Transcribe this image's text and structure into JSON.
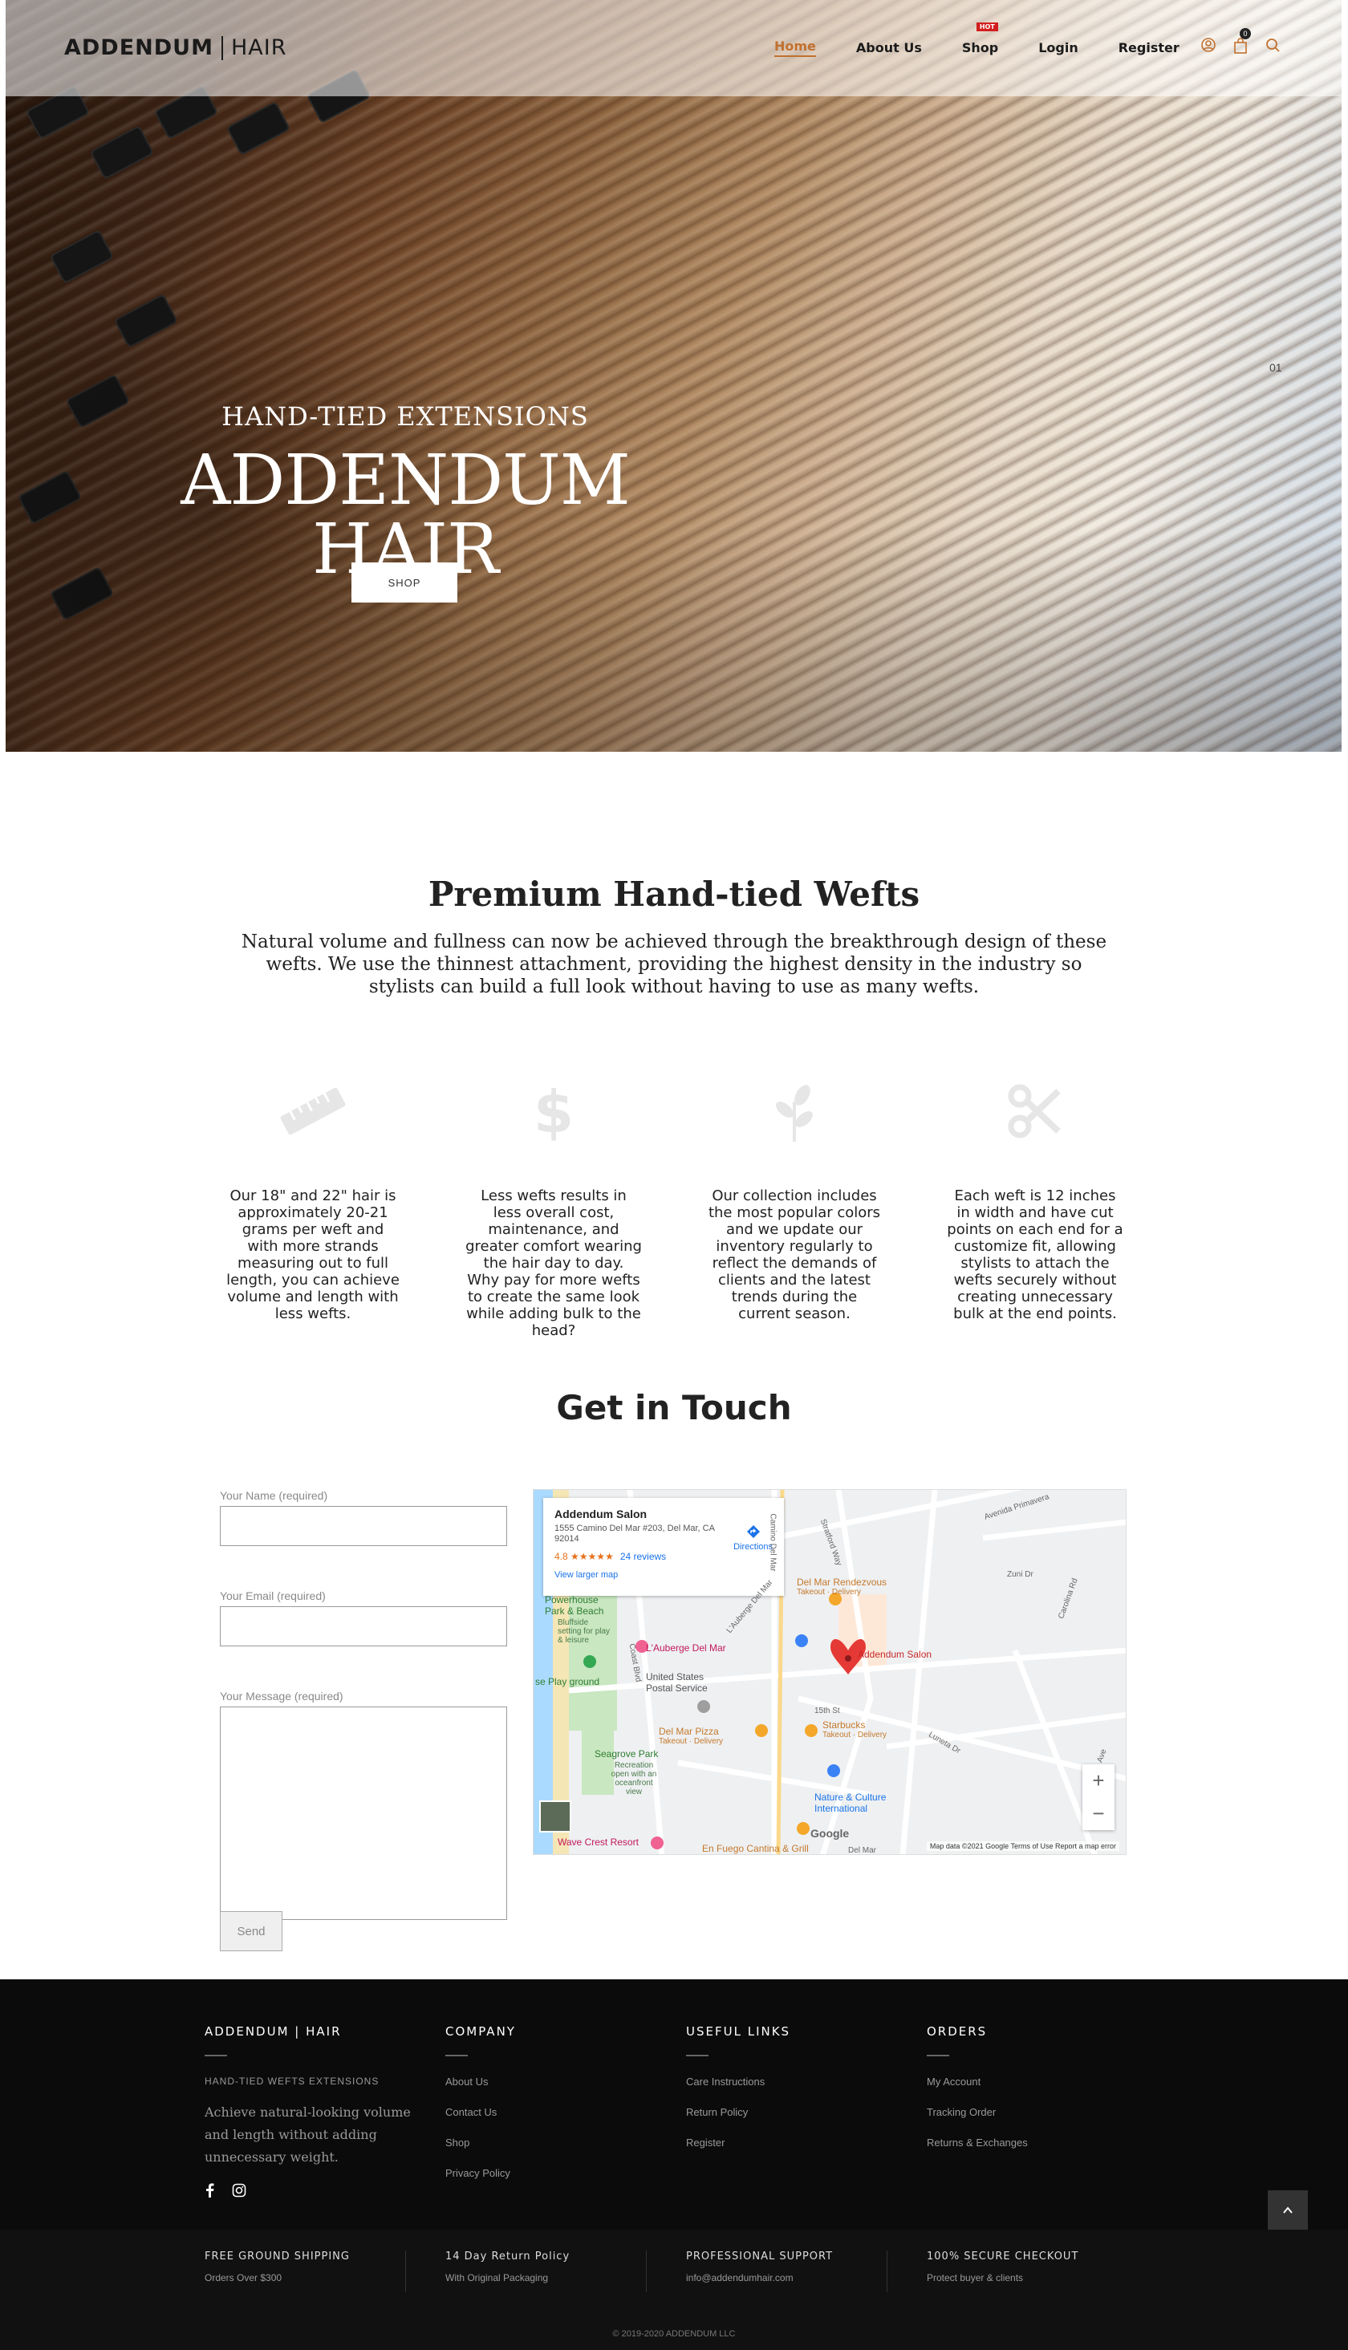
{
  "header": {
    "logo_main": "ADDENDUM",
    "logo_thin": "HAIR",
    "nav": [
      {
        "label": "Home"
      },
      {
        "label": "About Us"
      },
      {
        "label": "Shop",
        "badge": "HOT"
      },
      {
        "label": "Login"
      },
      {
        "label": "Register"
      }
    ],
    "cart_count": "0",
    "accent_color": "#c2702e"
  },
  "hero": {
    "subtitle": "HAND-TIED EXTENSIONS",
    "title": "ADDENDUM HAIR",
    "button": "SHOP",
    "slide_number": "01"
  },
  "premium": {
    "title": "Premium Hand-tied Wefts",
    "description": "Natural volume and fullness can now be achieved through the breakthrough design of these wefts. We use the thinnest attachment, providing the highest density in the industry so stylists can build a full look without having to use as many wefts."
  },
  "features": [
    {
      "icon": "ruler-icon",
      "text": "Our 18\" and 22\" hair is approximately 20-21 grams per weft and with more strands measuring out to full length, you can achieve volume and length with less wefts."
    },
    {
      "icon": "dollar-icon",
      "text": "Less wefts results in less overall cost, maintenance, and greater comfort wearing the hair day to day. Why pay for more wefts to create the same look while adding bulk to the head?"
    },
    {
      "icon": "leaf-icon",
      "text": "Our collection includes the most popular colors and we update our inventory regularly to reflect the demands of clients and the latest trends during the current season."
    },
    {
      "icon": "scissors-icon",
      "text": "Each weft is 12 inches in width and have cut points on each end for a customize fit, allowing stylists to attach the wefts securely without creating unnecessary bulk at the end points."
    }
  ],
  "contact": {
    "title": "Get in Touch",
    "name_label": "Your Name (required)",
    "email_label": "Your Email (required)",
    "message_label": "Your Message (required)",
    "send": "Send"
  },
  "map": {
    "place": "Addendum Salon",
    "address": "1555 Camino Del Mar #203, Del Mar, CA 92014",
    "rating": "4.8",
    "stars": "★★★★★",
    "reviews": "24 reviews",
    "larger": "View larger map",
    "directions": "Directions",
    "labels": {
      "rendezvous": "Del Mar Rendezvous",
      "rendezvous_sub": "Takeout · Delivery",
      "powerhouse": "Powerhouse Park & Beach",
      "bluffside": "Bluffside setting for play & leisure",
      "auberge": "L'Auberge Del Mar",
      "postal": "United States Postal Service",
      "play": "se Play ground",
      "pizza": "Del Mar Pizza",
      "pizza_sub": "Takeout · Delivery",
      "starbucks": "Starbucks",
      "starbucks_sub": "Takeout · Delivery",
      "seagrove": "Seagrove Park",
      "seagrove_sub": "Recreation open with an oceanfront view",
      "nature": "Nature & Culture International",
      "wave": "Wave Crest Resort",
      "fuego": "En Fuego Cantina & Grill",
      "salon_pin": "Addendum Salon",
      "st15": "15th St",
      "camino": "Camino Del Mar",
      "lauberge_st": "L'Auberge Del Mar",
      "primavera": "Avenida Primavera",
      "zuni": "Zuni Dr",
      "luneta": "Luneta Dr",
      "carolina": "Carolina Rd",
      "stratford": "Stratford Way",
      "coast": "Coast Blvd",
      "ave": "Ave",
      "del_mar_short": "Del Mar"
    },
    "google": "Google",
    "footer": "Map data ©2021 Google   Terms of Use   Report a map error",
    "zoom_in": "+",
    "zoom_out": "−"
  },
  "footer": {
    "brand": {
      "title": "ADDENDUM | HAIR",
      "tagline": "HAND-TIED WEFTS EXTENSIONS",
      "about": "Achieve natural-looking volume and length without adding unnecessary weight."
    },
    "company": {
      "title": "COMPANY",
      "links": [
        "About Us",
        "Contact Us",
        "Shop",
        "Privacy Policy"
      ]
    },
    "useful": {
      "title": "USEFUL LINKS",
      "links": [
        "Care Instructions",
        "Return Policy",
        "Register"
      ]
    },
    "orders": {
      "title": "ORDERS",
      "links": [
        "My Account",
        "Tracking Order",
        "Returns & Exchanges"
      ]
    }
  },
  "perks": [
    {
      "title": "FREE GROUND SHIPPING",
      "text": "Orders Over $300"
    },
    {
      "title": "14 Day Return Policy",
      "text": "With Original Packaging"
    },
    {
      "title": "PROFESSIONAL SUPPORT",
      "text": "info@addendumhair.com"
    },
    {
      "title": "100% SECURE CHECKOUT",
      "text": "Protect buyer & clients"
    }
  ],
  "copyright": "© 2019-2020 ADDENDUM LLC"
}
